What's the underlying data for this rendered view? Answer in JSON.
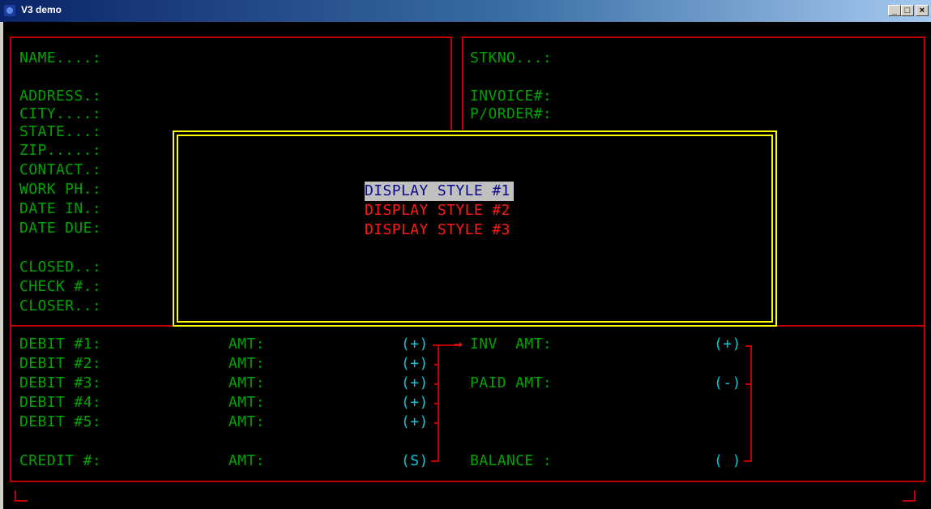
{
  "window": {
    "title": "V3 demo",
    "minimize": "_",
    "maximize": "□",
    "close": "×"
  },
  "form": {
    "left_labels": [
      "NAME....:",
      "ADDRESS.:",
      "CITY....:",
      "STATE...:",
      "ZIP.....:",
      "CONTACT.:",
      "WORK PH.:",
      "DATE IN.:",
      "DATE DUE:",
      "CLOSED..:",
      "CHECK #.:",
      "CLOSER..:"
    ],
    "right_labels": [
      "STKNO...:",
      "INVOICE#:",
      "P/ORDER#:"
    ]
  },
  "dialog": {
    "options": [
      "DISPLAY STYLE #1",
      "DISPLAY STYLE #2",
      "DISPLAY STYLE #3"
    ],
    "selected_index": 0
  },
  "ledger": {
    "debits": [
      "DEBIT #1:",
      "DEBIT #2:",
      "DEBIT #3:",
      "DEBIT #4:",
      "DEBIT #5:"
    ],
    "credit": "CREDIT #:",
    "amt_label": "AMT:",
    "signs": [
      "(+)",
      "(+)",
      "(+)",
      "(+)",
      "(+)",
      "(S)"
    ],
    "arrow": "→",
    "inv_amt": "INV  AMT:",
    "paid_amt": "PAID AMT:",
    "balance": "BALANCE :",
    "inv_sign": "(+)",
    "paid_sign": "(-)",
    "balance_sign": "( )"
  },
  "colors": {
    "label": "#00a400",
    "sign": "#00c8d8",
    "rule": "#c00000",
    "dialog_border": "#ffff00",
    "option": "#ff1a1a"
  }
}
